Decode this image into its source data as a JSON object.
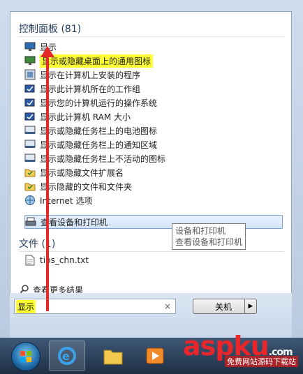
{
  "control_panel": {
    "header": "控制面板 (81)",
    "items": [
      {
        "label": "显示",
        "icon": "monitor-icon"
      },
      {
        "label": "显示或隐藏桌面上的通用图标",
        "icon": "desktop-icon",
        "highlight": true
      },
      {
        "label": "显示在计算机上安装的程序",
        "icon": "programs-icon"
      },
      {
        "label": "显示此计算机所在的工作组",
        "icon": "system-icon"
      },
      {
        "label": "显示您的计算机运行的操作系统",
        "icon": "system-icon"
      },
      {
        "label": "显示此计算机 RAM 大小",
        "icon": "system-icon"
      },
      {
        "label": "显示或隐藏任务栏上的电池图标",
        "icon": "taskbar-icon"
      },
      {
        "label": "显示或隐藏任务栏上的通知区域",
        "icon": "taskbar-icon"
      },
      {
        "label": "显示或隐藏任务栏上不活动的图标",
        "icon": "taskbar-icon"
      },
      {
        "label": "显示或隐藏文件扩展名",
        "icon": "folder-options-icon"
      },
      {
        "label": "显示隐藏的文件和文件夹",
        "icon": "folder-options-icon"
      },
      {
        "label": "Internet 选项",
        "icon": "internet-options-icon"
      },
      {
        "label": "查看设备和打印机",
        "icon": "printer-icon",
        "selected": true
      }
    ]
  },
  "files": {
    "header": "文件 (1)",
    "items": [
      {
        "label": "tips_chn.txt",
        "icon": "text-file-icon"
      }
    ]
  },
  "tooltip": {
    "line1": "设备和打印机",
    "line2": "查看设备和打印机"
  },
  "more_results": "查看更多结果",
  "search": {
    "value": "显示",
    "clear": "×"
  },
  "shutdown": {
    "label": "关机",
    "arrow": "▶"
  },
  "watermark": {
    "main": "aspku",
    "suffix": ".com",
    "sub": "免费网站源码下载站"
  }
}
